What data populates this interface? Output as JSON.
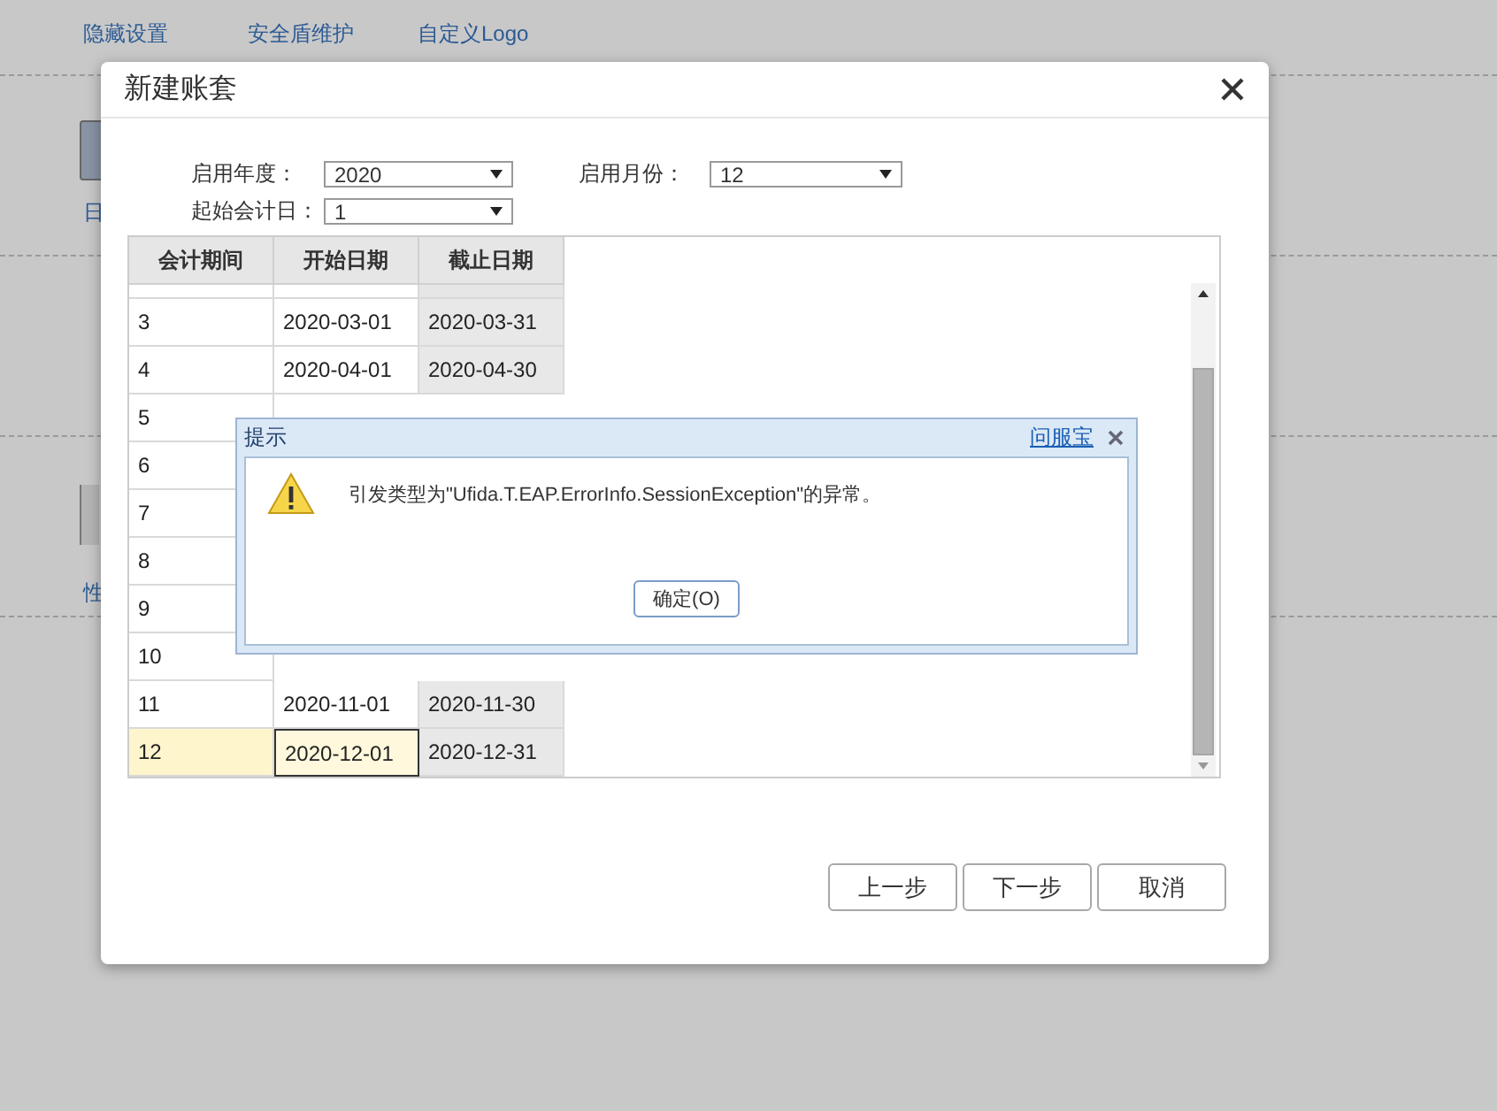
{
  "background": {
    "tools": [
      {
        "label": "隐藏设置"
      },
      {
        "label": "安全盾维护"
      },
      {
        "label": "自定义Logo"
      }
    ],
    "side_labels": [
      "日",
      "性"
    ]
  },
  "dialog": {
    "title": "新建账套",
    "form": [
      {
        "label": "启用年度：",
        "value": "2020"
      },
      {
        "label": "启用月份：",
        "value": "12"
      },
      {
        "label": "起始会计日：",
        "value": "1"
      }
    ],
    "table": {
      "columns": [
        "会计期间",
        "开始日期",
        "截止日期"
      ],
      "rows": [
        {
          "period": "3",
          "start": "2020-03-01",
          "end": "2020-03-31",
          "selected": false
        },
        {
          "period": "4",
          "start": "2020-04-01",
          "end": "2020-04-30",
          "selected": false
        },
        {
          "period": "5",
          "selected": false
        },
        {
          "period": "6",
          "selected": false
        },
        {
          "period": "7",
          "selected": false
        },
        {
          "period": "8",
          "selected": false
        },
        {
          "period": "9",
          "selected": false
        },
        {
          "period": "10",
          "selected": false
        },
        {
          "period": "11",
          "start": "2020-11-01",
          "end": "2020-11-30",
          "selected": false
        },
        {
          "period": "12",
          "start": "2020-12-01",
          "end": "2020-12-31",
          "selected": true
        }
      ]
    },
    "buttons": [
      "上一步",
      "下一步",
      "取消"
    ]
  },
  "alert": {
    "title": "提示",
    "link": "问服宝",
    "message": "引发类型为\"Ufida.T.EAP.ErrorInfo.SessionException\"的异常。",
    "button": "确定(O)"
  }
}
